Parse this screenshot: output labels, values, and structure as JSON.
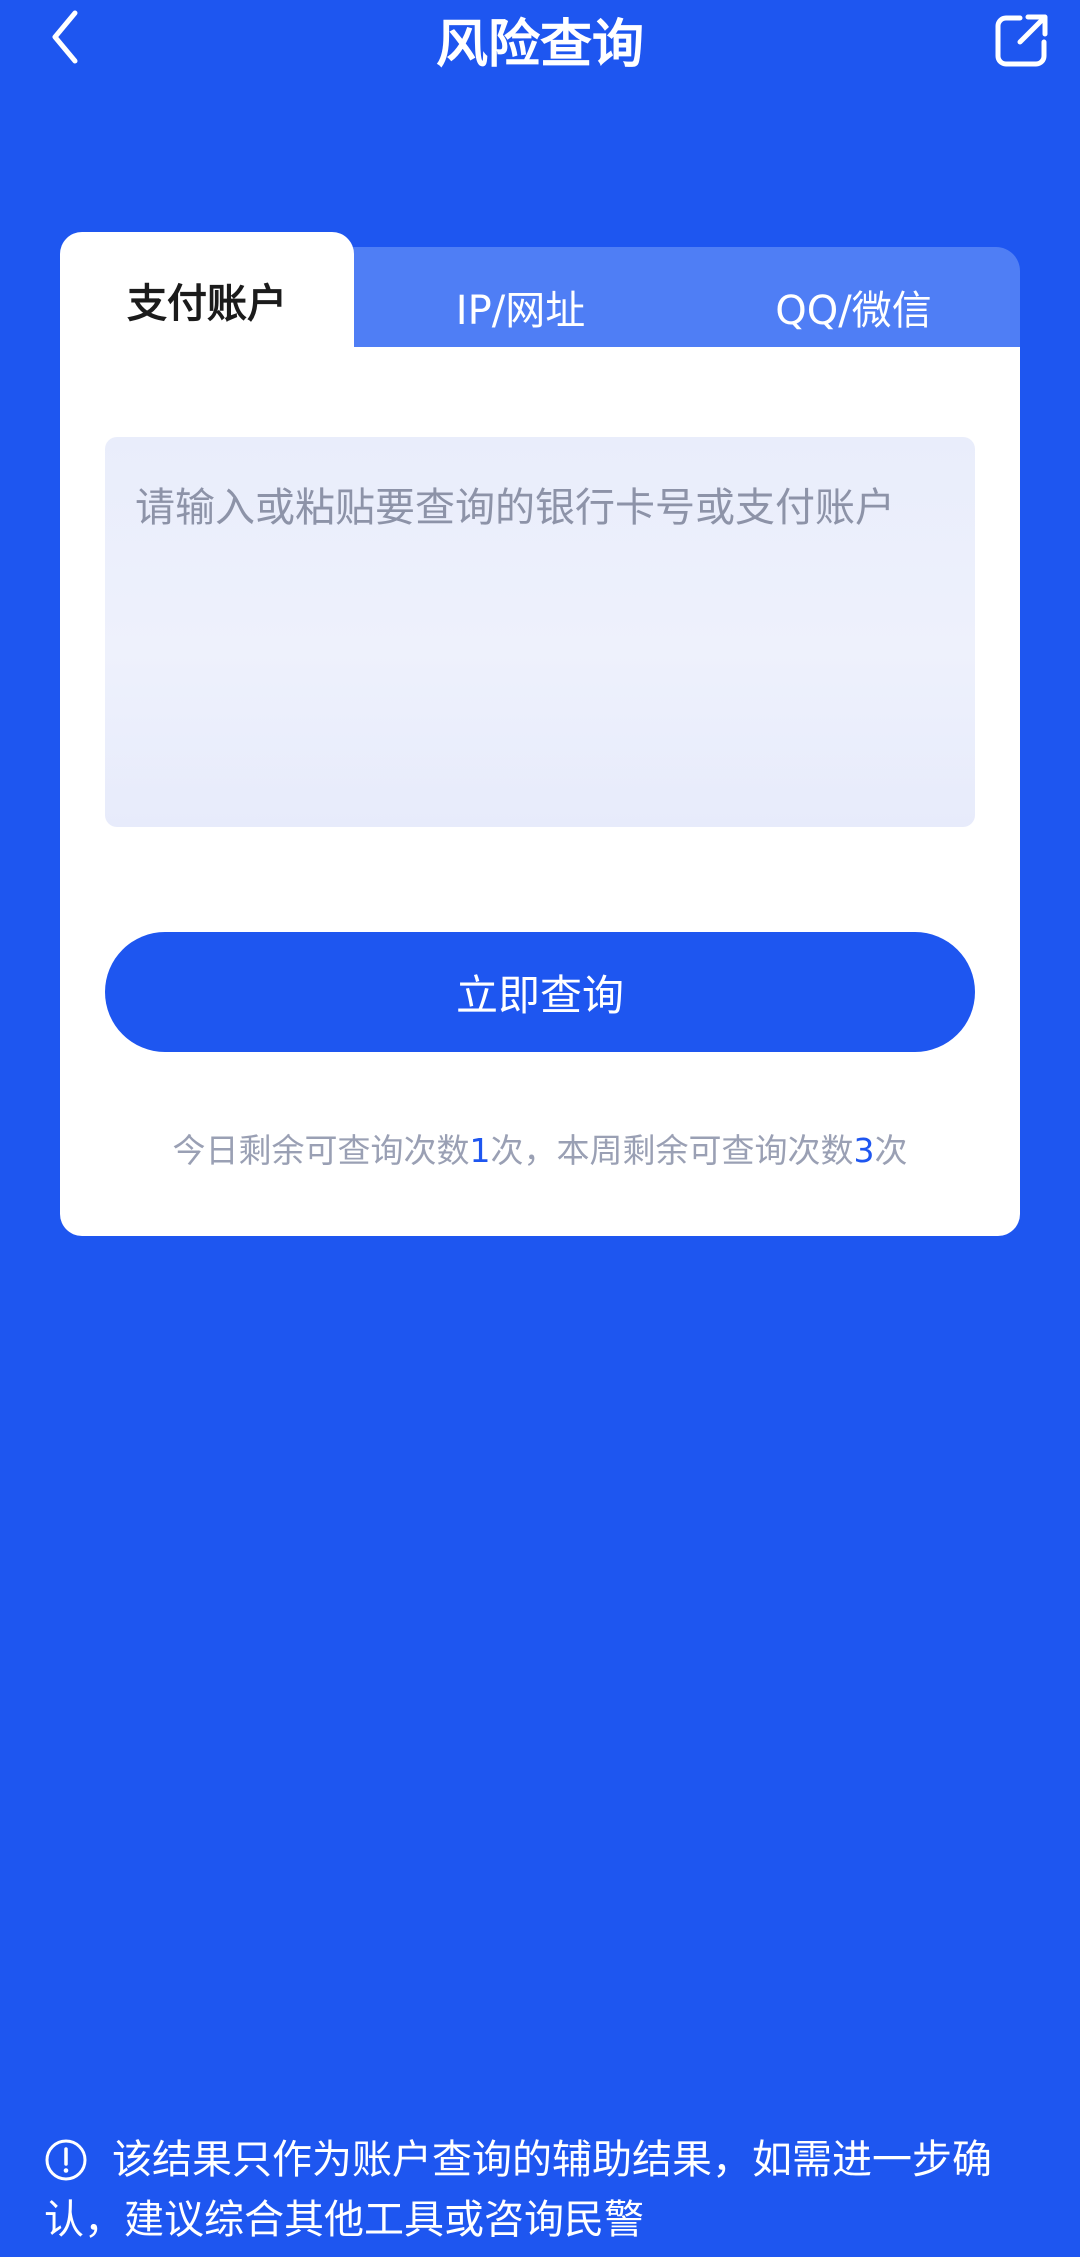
{
  "header": {
    "title": "风险查询",
    "back_icon": "chevron-left-icon",
    "share_icon": "external-link-icon"
  },
  "tabs": [
    {
      "label": "支付账户",
      "active": true
    },
    {
      "label": "IP/网址",
      "active": false
    },
    {
      "label": "QQ/微信",
      "active": false
    }
  ],
  "input": {
    "placeholder": "请输入或粘贴要查询的银行卡号或支付账户",
    "value": ""
  },
  "query_button": {
    "label": "立即查询"
  },
  "quota": {
    "prefix": "今日剩余可查询次数",
    "today_count": "1",
    "middle": "次，本周剩余可查询次数",
    "week_count": "3",
    "suffix": "次"
  },
  "note": {
    "icon": "info-circle-icon",
    "text": "该结果只作为账户查询的辅助结果，如需进一步确认，建议综合其他工具或咨询民警"
  },
  "colors": {
    "background": "#1e56f0",
    "tab_bar": "#4f7ef5",
    "card": "#ffffff",
    "accent": "#1e56f0",
    "muted_text": "#9aa0b4"
  }
}
